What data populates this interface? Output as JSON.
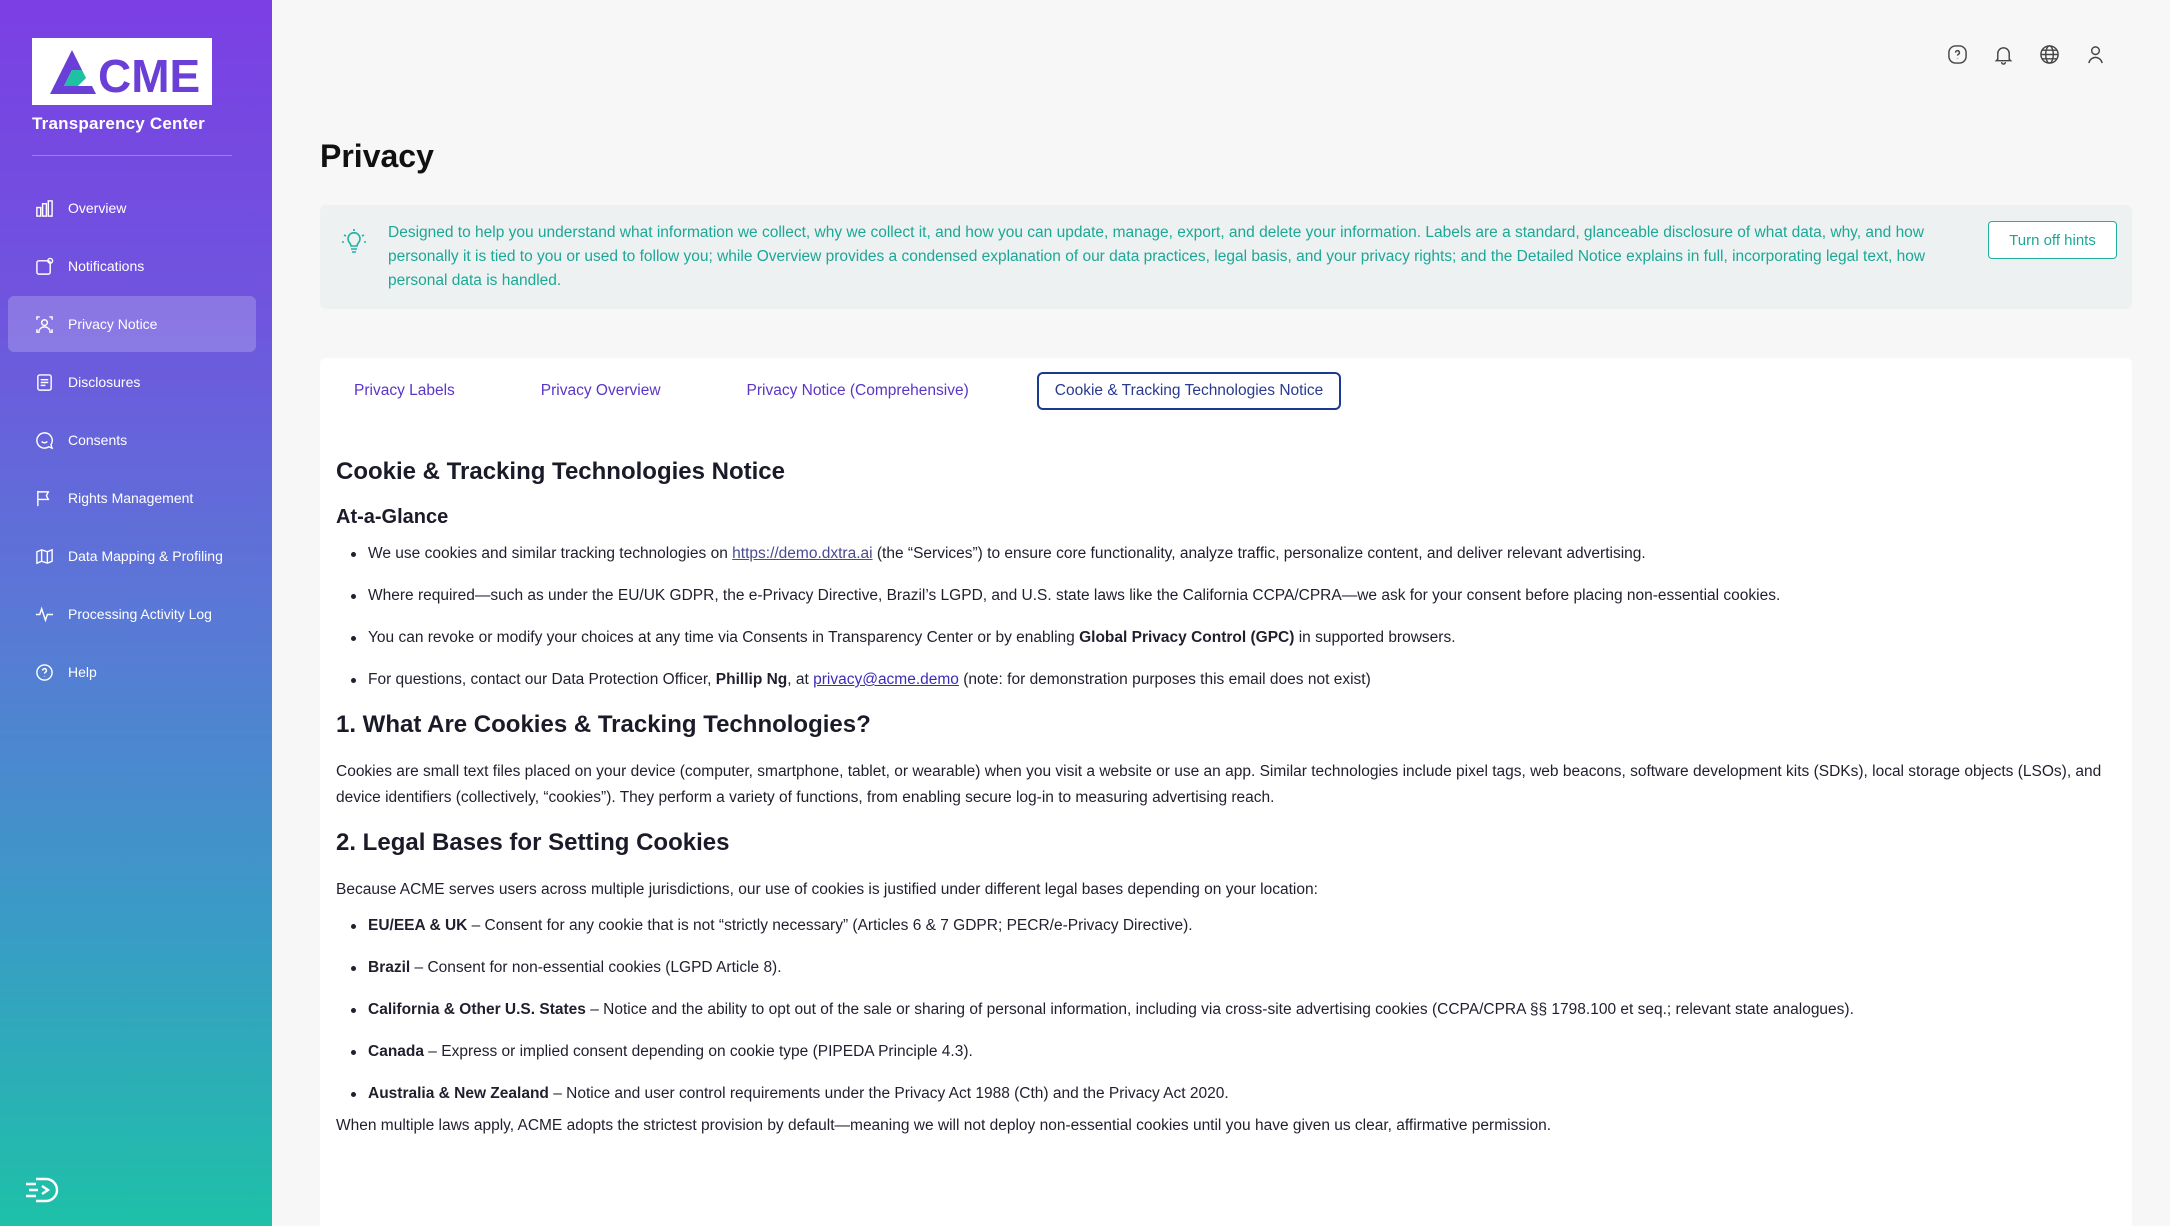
{
  "brand": {
    "logo_text": "CME",
    "subtitle": "Transparency Center"
  },
  "nav": [
    {
      "label": "Overview",
      "icon": "chart-icon"
    },
    {
      "label": "Notifications",
      "icon": "notification-icon"
    },
    {
      "label": "Privacy Notice",
      "icon": "privacy-icon",
      "active": true
    },
    {
      "label": "Disclosures",
      "icon": "document-icon"
    },
    {
      "label": "Consents",
      "icon": "chat-icon"
    },
    {
      "label": "Rights Management",
      "icon": "flag-icon"
    },
    {
      "label": "Data Mapping & Profiling",
      "icon": "map-icon"
    },
    {
      "label": "Processing Activity Log",
      "icon": "activity-icon"
    },
    {
      "label": "Help",
      "icon": "help-icon"
    }
  ],
  "top_icons": [
    "help-icon",
    "bell-icon",
    "globe-icon",
    "user-icon"
  ],
  "page": {
    "title": "Privacy"
  },
  "hint": {
    "text": "Designed to help you understand what information we collect, why we collect it, and how you can update, manage, export, and delete your information. Labels are a standard, glanceable disclosure of what data, why, and how personally it is tied to you or used to follow you; while Overview provides a condensed explanation of our data practices, legal basis, and your privacy rights; and the Detailed Notice explains in full, incorporating legal text, how personal data is handled.",
    "button": "Turn off hints"
  },
  "tabs": [
    {
      "label": "Privacy Labels"
    },
    {
      "label": "Privacy Overview"
    },
    {
      "label": "Privacy Notice (Comprehensive)"
    },
    {
      "label": "Cookie & Tracking Technologies Notice",
      "active": true
    }
  ],
  "notice": {
    "title": "Cookie & Tracking Technologies Notice",
    "glance_heading": "At-a-Glance",
    "glance": {
      "b1_pre": "We use cookies and similar tracking technologies on ",
      "b1_link": "https://demo.dxtra.ai",
      "b1_post": " (the “Services”) to ensure core functionality, analyze traffic, personalize content, and deliver relevant advertising.",
      "b2": "Where required—such as under the EU/UK GDPR, the e-Privacy Directive, Brazil’s LGPD, and U.S. state laws like the California CCPA/CPRA—we ask for your consent before placing non-essential cookies.",
      "b3_pre": "You can revoke or modify your choices at any time via Consents in Transparency Center or by enabling ",
      "b3_bold": "Global Privacy Control (GPC)",
      "b3_post": " in supported browsers.",
      "b4_pre": "For questions, contact our Data Protection Officer, ",
      "b4_bold": "Phillip Ng",
      "b4_mid": ", at ",
      "b4_link": "privacy@acme.demo",
      "b4_post": " (note: for demonstration purposes this email does not exist)"
    },
    "s1_heading": "1. What Are Cookies & Tracking Technologies?",
    "s1_text": "Cookies are small text files placed on your device (computer, smartphone, tablet, or wearable) when you visit a website or use an app. Similar technologies include pixel tags, web beacons, software development kits (SDKs), local storage objects (LSOs), and device identifiers (collectively, “cookies”). They perform a variety of functions, from enabling secure log-in to measuring advertising reach.",
    "s2_heading": "2. Legal Bases for Setting Cookies",
    "s2_intro": "Because ACME serves users across multiple jurisdictions, our use of cookies is justified under different legal bases depending on your location:",
    "s2_items": [
      {
        "region": "EU/EEA & UK",
        "text": " – Consent for any cookie that is not “strictly necessary” (Articles 6 & 7 GDPR; PECR/e-Privacy Directive)."
      },
      {
        "region": "Brazil",
        "text": " – Consent for non-essential cookies (LGPD Article 8)."
      },
      {
        "region": "California & Other U.S. States",
        "text": " – Notice and the ability to opt out of the sale or sharing of personal information, including via cross-site advertising cookies (CCPA/CPRA §§ 1798.100 et seq.; relevant state analogues)."
      },
      {
        "region": "Canada",
        "text": " – Express or implied consent depending on cookie type (PIPEDA Principle 4.3)."
      },
      {
        "region": "Australia & New Zealand",
        "text": " – Notice and user control requirements under the Privacy Act 1988 (Cth) and the Privacy Act 2020."
      }
    ],
    "s2_outro": "When multiple laws apply, ACME adopts the strictest provision by default—meaning we will not deploy non-essential cookies until you have given us clear, affirmative permission."
  }
}
